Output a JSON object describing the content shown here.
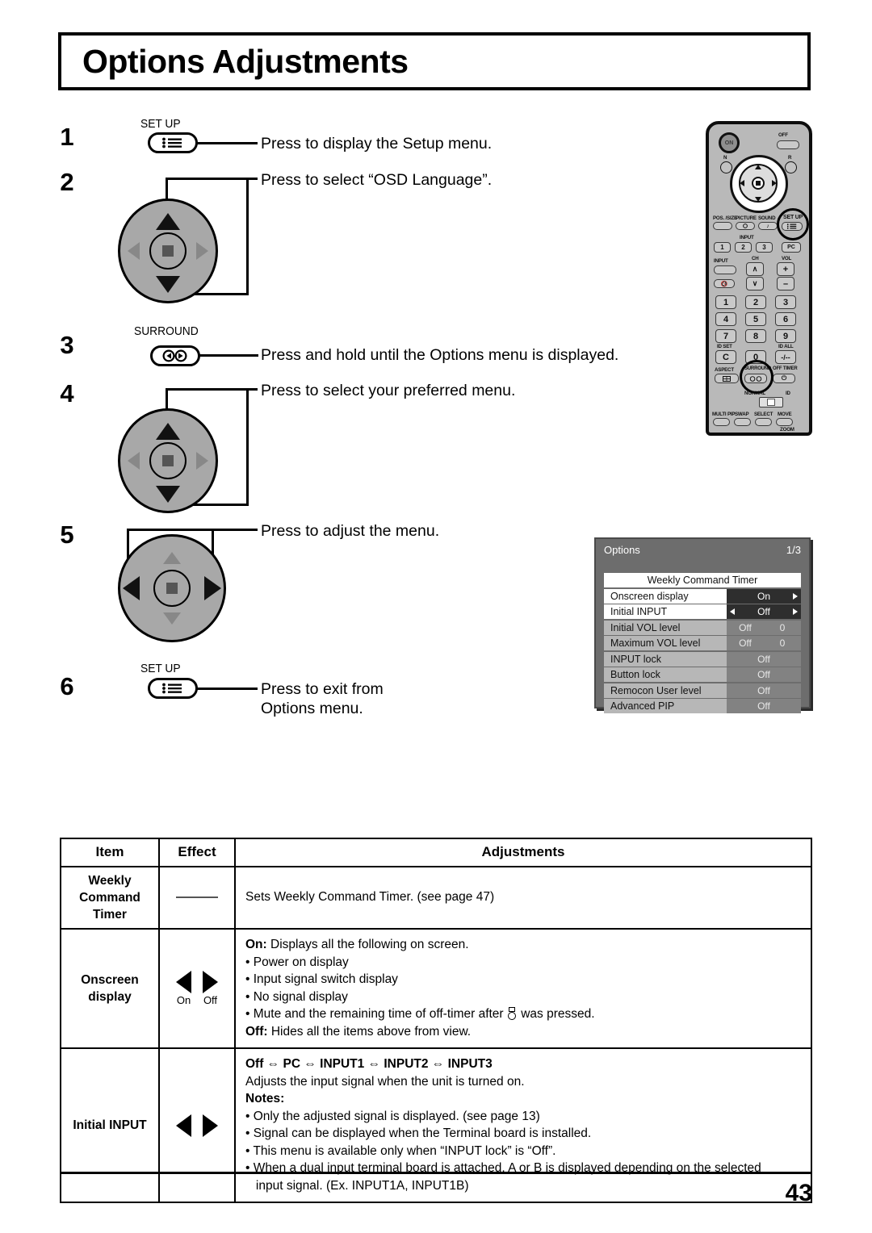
{
  "header": {
    "title": "Options Adjustments"
  },
  "steps": [
    {
      "num": "1",
      "button_label": "SET UP",
      "button_icon": "setup-menu-icon",
      "text": "Press to display the Setup menu."
    },
    {
      "num": "2",
      "button_icon": "nav-pad-up-down",
      "text": "Press to select “OSD Language”."
    },
    {
      "num": "3",
      "button_label": "SURROUND",
      "button_icon": "surround-icon",
      "text": "Press and hold until the Options menu is displayed."
    },
    {
      "num": "4",
      "button_icon": "nav-pad-up-down",
      "text": "Press to select your preferred menu."
    },
    {
      "num": "5",
      "button_icon": "nav-pad-left-right",
      "text": "Press to adjust the menu."
    },
    {
      "num": "6",
      "button_label": "SET UP",
      "button_icon": "setup-menu-icon",
      "text_line1": "Press to exit from",
      "text_line2": "Options menu."
    }
  ],
  "remote": {
    "power_on": "ON",
    "power_off": "OFF",
    "n_label": "N",
    "r_label": "R",
    "row_labels": {
      "pos_size": "POS. /SIZE",
      "picture": "PICTURE",
      "sound": "SOUND",
      "setup": "SET UP"
    },
    "input_group": "INPUT",
    "input_keys": [
      "1",
      "2",
      "3",
      "PC"
    ],
    "input_button": "INPUT",
    "ch_label": "CH",
    "vol_label": "VOL",
    "vol_plus": "+",
    "vol_minus": "–",
    "ch_up": "∧",
    "ch_down": "∨",
    "numpad": [
      "1",
      "2",
      "3",
      "4",
      "5",
      "6",
      "7",
      "8",
      "9",
      "C",
      "0",
      "-/--"
    ],
    "id_set": "ID SET",
    "id_all": "ID ALL",
    "aspect": "ASPECT",
    "surround": "SURROUND",
    "off_timer": "OFF TIMER",
    "normal": "NORMAL",
    "id": "ID",
    "bottom_keys": [
      "MULTI PIP",
      "SWAP",
      "SELECT",
      "MOVE"
    ],
    "zoom": "ZOOM",
    "highlights": [
      "setup-key",
      "surround-key"
    ]
  },
  "osd": {
    "title": "Options",
    "page_indicator": "1/3",
    "rows": [
      {
        "name": "Weekly Command Timer",
        "value": "",
        "style": "title"
      },
      {
        "name": "Onscreen display",
        "value": "On",
        "style": "selected",
        "arrow_left": false,
        "arrow_right": true
      },
      {
        "name": "Initial INPUT",
        "value": "Off",
        "style": "selected",
        "arrow_left": true,
        "arrow_right": true
      },
      {
        "name": "Initial VOL level",
        "value": "Off",
        "value2": "0",
        "style": "normal"
      },
      {
        "name": "Maximum VOL level",
        "value": "Off",
        "value2": "0",
        "style": "normal"
      },
      {
        "name": "INPUT lock",
        "value": "Off",
        "style": "normal"
      },
      {
        "name": "Button lock",
        "value": "Off",
        "style": "normal"
      },
      {
        "name": "Remocon User level",
        "value": "Off",
        "style": "normal"
      },
      {
        "name": "Advanced PIP",
        "value": "Off",
        "style": "normal"
      }
    ]
  },
  "table": {
    "headers": {
      "item": "Item",
      "effect": "Effect",
      "adjustments": "Adjustments"
    },
    "rows": [
      {
        "item_lines": [
          "Weekly",
          "Command",
          "Timer"
        ],
        "effect": "dash",
        "adjustments_text": "Sets Weekly Command Timer. (see page 47)"
      },
      {
        "item_lines": [
          "Onscreen",
          "display"
        ],
        "effect": "arrows",
        "effect_left_label": "On",
        "effect_right_label": "Off",
        "on_heading": "On:",
        "on_desc": "Displays all the following on screen.",
        "bullets": [
          "• Power on display",
          "• Input signal switch display",
          "• No signal display"
        ],
        "bullet_mute_pre": "• Mute and the remaining time of off-timer after",
        "bullet_mute_post": "was pressed.",
        "off_heading": "Off:",
        "off_desc": "Hides all the items above from view."
      },
      {
        "item_lines": [
          "Initial INPUT"
        ],
        "effect": "arrows",
        "sequence": "Off ⇔ PC ⇔ INPUT1 ⇔ INPUT2 ⇔ INPUT3",
        "desc": "Adjusts the input signal when the unit is turned on.",
        "notes_heading": "Notes:",
        "notes": [
          "• Only the adjusted signal is displayed. (see page 13)",
          "• Signal can be displayed when the Terminal board is installed.",
          "• This menu is available only when “INPUT lock” is “Off”.",
          "• When a dual input terminal board is attached, A or B is displayed depending on the selected",
          "   input signal. (Ex. INPUT1A, INPUT1B)"
        ]
      }
    ]
  },
  "footer": {
    "page_number": "43"
  }
}
